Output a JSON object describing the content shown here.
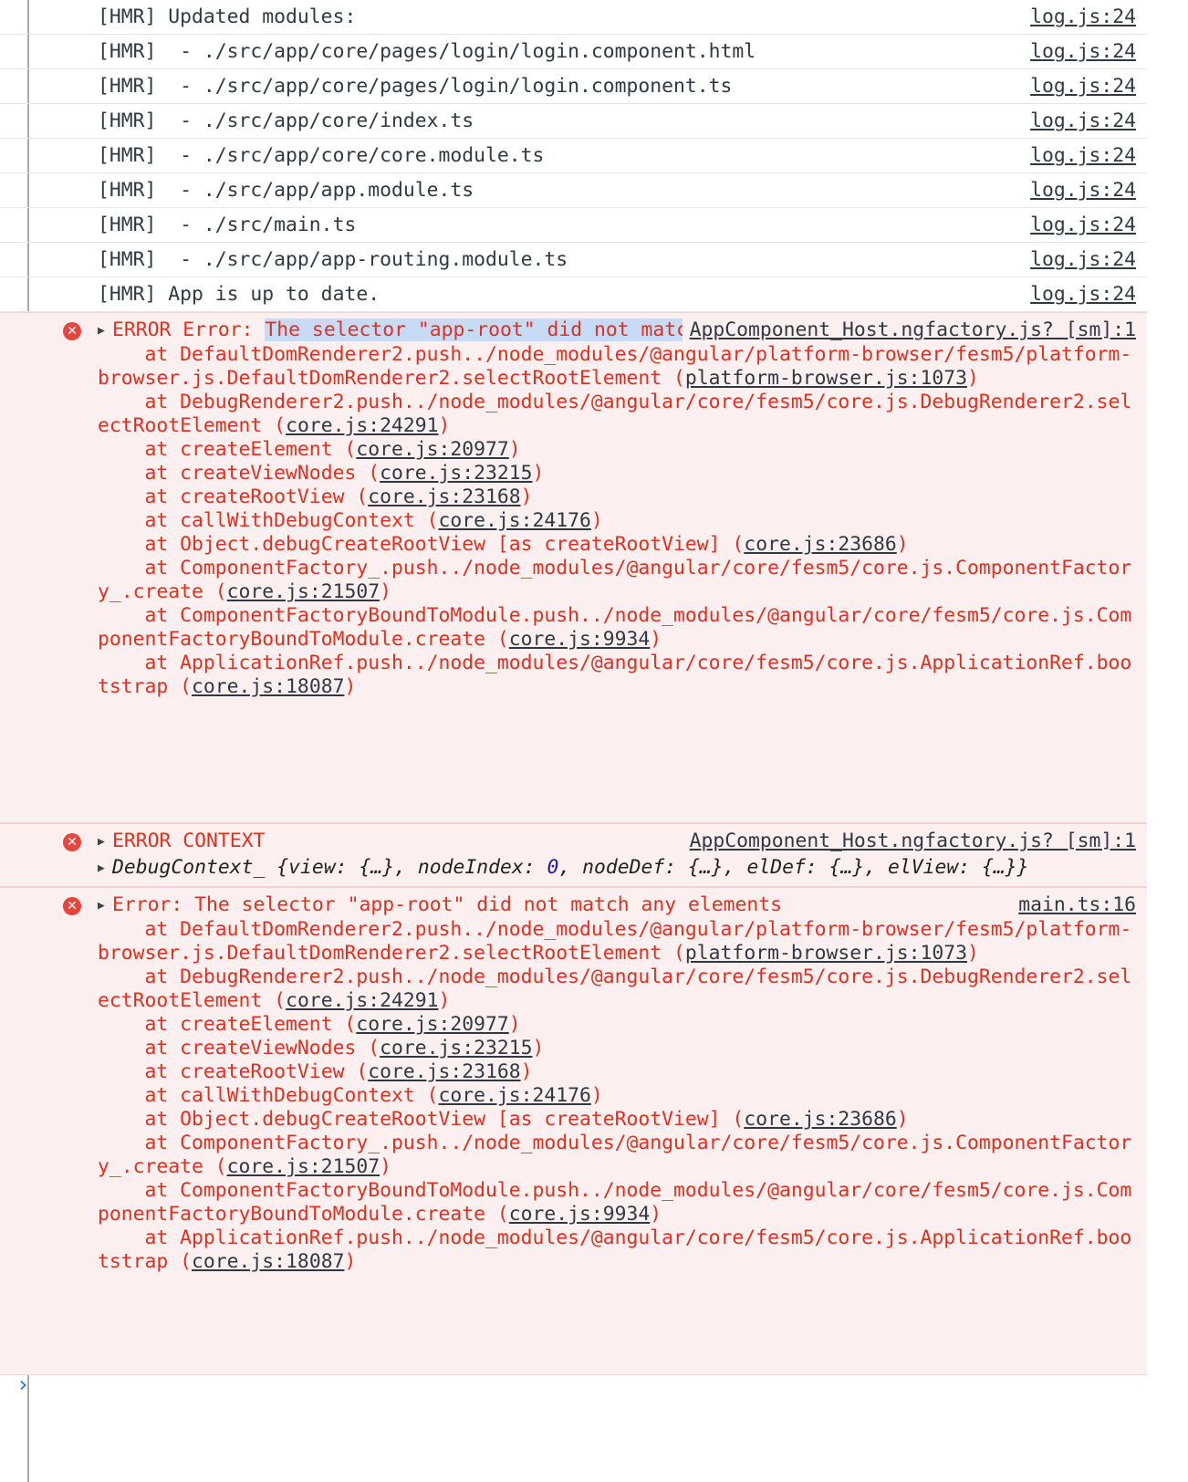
{
  "logs": [
    {
      "text": "[HMR] Updated modules:",
      "src": "log.js:24"
    },
    {
      "text": "[HMR]  - ./src/app/core/pages/login/login.component.html",
      "src": "log.js:24"
    },
    {
      "text": "[HMR]  - ./src/app/core/pages/login/login.component.ts",
      "src": "log.js:24"
    },
    {
      "text": "[HMR]  - ./src/app/core/index.ts",
      "src": "log.js:24"
    },
    {
      "text": "[HMR]  - ./src/app/core/core.module.ts",
      "src": "log.js:24"
    },
    {
      "text": "[HMR]  - ./src/app/app.module.ts",
      "src": "log.js:24"
    },
    {
      "text": "[HMR]  - ./src/main.ts",
      "src": "log.js:24"
    },
    {
      "text": "[HMR]  - ./src/app/app-routing.module.ts",
      "src": "log.js:24"
    },
    {
      "text": "[HMR] App is up to date.",
      "src": "log.js:24"
    }
  ],
  "error1": {
    "prefix": "ERROR Error: ",
    "highlighted": "The selector \"app-root\" did not match any elements",
    "src": "AppComponent_Host.ngfactory.js? [sm]:1",
    "stack": [
      {
        "pre": "    at DefaultDomRenderer2.push../node_modules/@angular/platform-browser/fesm5/platform-browser.js.DefaultDomRenderer2.selectRootElement (",
        "link": "platform-browser.js:1073",
        "post": ")"
      },
      {
        "pre": "    at DebugRenderer2.push../node_modules/@angular/core/fesm5/core.js.DebugRenderer2.selectRootElement (",
        "link": "core.js:24291",
        "post": ")"
      },
      {
        "pre": "    at createElement (",
        "link": "core.js:20977",
        "post": ")"
      },
      {
        "pre": "    at createViewNodes (",
        "link": "core.js:23215",
        "post": ")"
      },
      {
        "pre": "    at createRootView (",
        "link": "core.js:23168",
        "post": ")"
      },
      {
        "pre": "    at callWithDebugContext (",
        "link": "core.js:24176",
        "post": ")"
      },
      {
        "pre": "    at Object.debugCreateRootView [as createRootView] (",
        "link": "core.js:23686",
        "post": ")"
      },
      {
        "pre": "    at ComponentFactory_.push../node_modules/@angular/core/fesm5/core.js.ComponentFactory_.create (",
        "link": "core.js:21507",
        "post": ")"
      },
      {
        "pre": "    at ComponentFactoryBoundToModule.push../node_modules/@angular/core/fesm5/core.js.ComponentFactoryBoundToModule.create (",
        "link": "core.js:9934",
        "post": ")"
      },
      {
        "pre": "    at ApplicationRef.push../node_modules/@angular/core/fesm5/core.js.ApplicationRef.bootstrap (",
        "link": "core.js:18087",
        "post": ")"
      }
    ]
  },
  "error2": {
    "title": "ERROR CONTEXT",
    "src": "AppComponent_Host.ngfactory.js? [sm]:1",
    "context_name": "DebugContext_",
    "context_body_a": " {view: {…}, nodeIndex: ",
    "context_index": "0",
    "context_body_b": ", nodeDef: {…}, elDef: {…}, elView: {…}}"
  },
  "error3": {
    "title": "Error: The selector \"app-root\" did not match any elements",
    "src": "main.ts:16",
    "stack": [
      {
        "pre": "    at DefaultDomRenderer2.push../node_modules/@angular/platform-browser/fesm5/platform-browser.js.DefaultDomRenderer2.selectRootElement (",
        "link": "platform-browser.js:1073",
        "post": ")"
      },
      {
        "pre": "    at DebugRenderer2.push../node_modules/@angular/core/fesm5/core.js.DebugRenderer2.selectRootElement (",
        "link": "core.js:24291",
        "post": ")"
      },
      {
        "pre": "    at createElement (",
        "link": "core.js:20977",
        "post": ")"
      },
      {
        "pre": "    at createViewNodes (",
        "link": "core.js:23215",
        "post": ")"
      },
      {
        "pre": "    at createRootView (",
        "link": "core.js:23168",
        "post": ")"
      },
      {
        "pre": "    at callWithDebugContext (",
        "link": "core.js:24176",
        "post": ")"
      },
      {
        "pre": "    at Object.debugCreateRootView [as createRootView] (",
        "link": "core.js:23686",
        "post": ")"
      },
      {
        "pre": "    at ComponentFactory_.push../node_modules/@angular/core/fesm5/core.js.ComponentFactory_.create (",
        "link": "core.js:21507",
        "post": ")"
      },
      {
        "pre": "    at ComponentFactoryBoundToModule.push../node_modules/@angular/core/fesm5/core.js.ComponentFactoryBoundToModule.create (",
        "link": "core.js:9934",
        "post": ")"
      },
      {
        "pre": "    at ApplicationRef.push../node_modules/@angular/core/fesm5/core.js.ApplicationRef.bootstrap (",
        "link": "core.js:18087",
        "post": ")"
      }
    ]
  },
  "prompt_symbol": "›",
  "icons": {
    "error": "error-icon",
    "expand": "expand-triangle-icon",
    "prompt": "prompt-chevron-icon"
  }
}
